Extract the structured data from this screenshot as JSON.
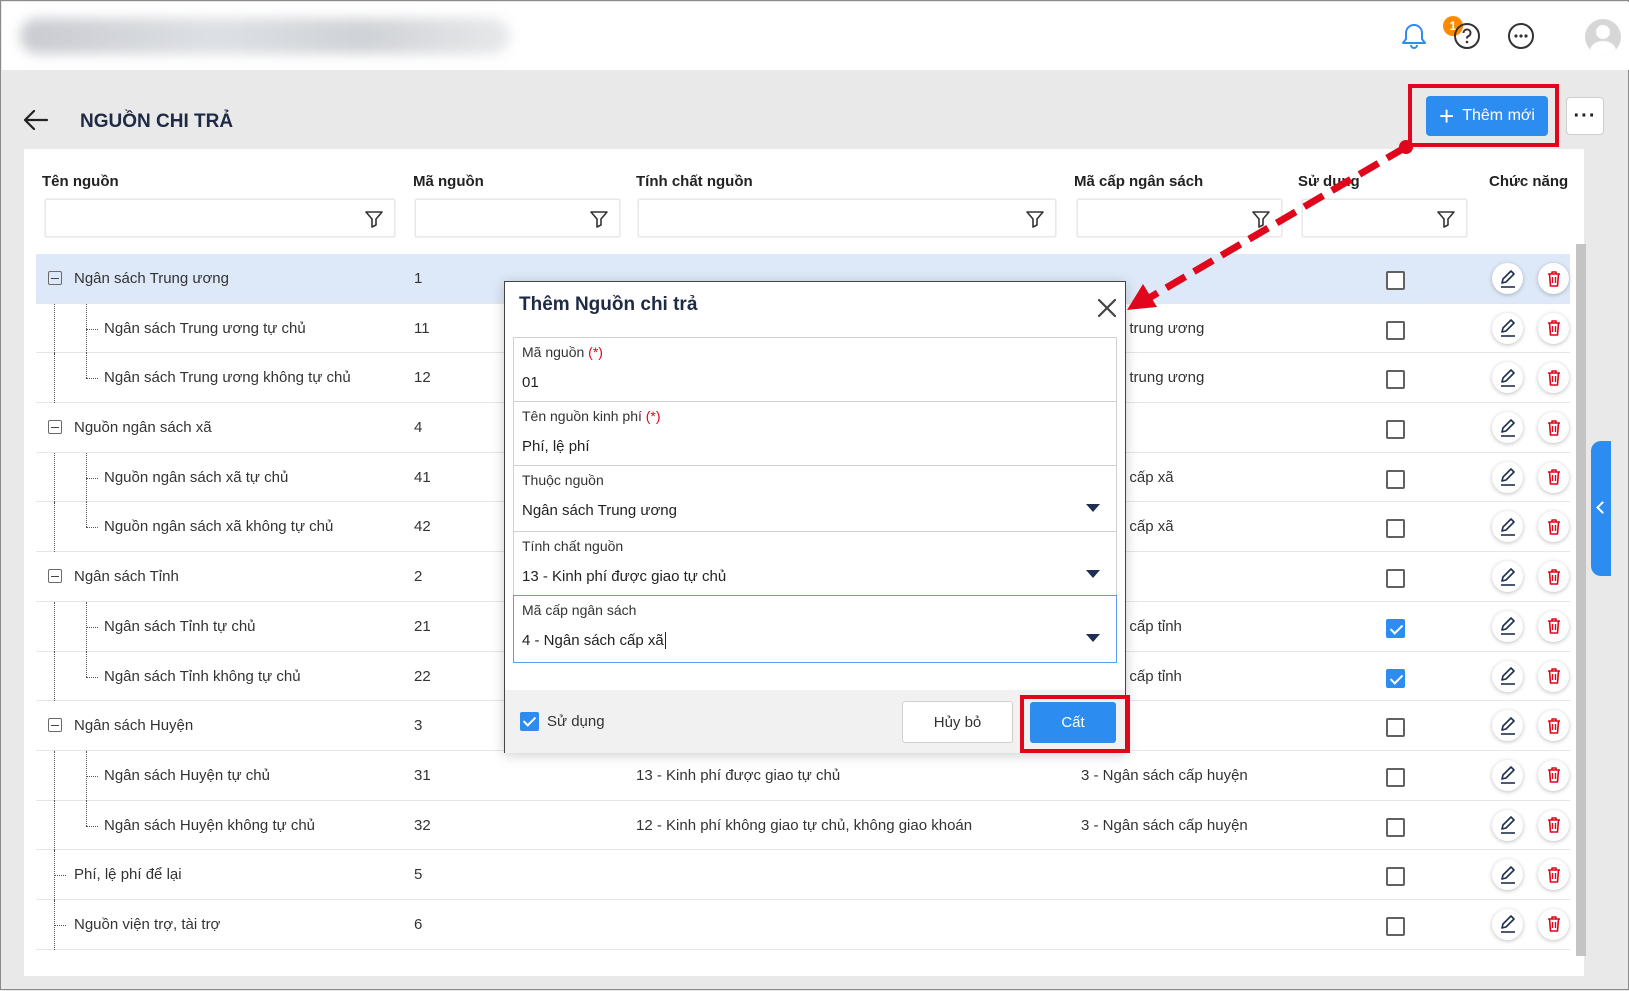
{
  "topbar": {
    "notification_count": "1"
  },
  "header": {
    "title": "NGUỒN CHI TRẢ",
    "add_label": "Thêm mới",
    "more_label": "···"
  },
  "table": {
    "columns": [
      "Tên nguồn",
      "Mã nguồn",
      "Tính chất nguồn",
      "Mã cấp ngân sách",
      "Sử dụng",
      "Chức năng"
    ],
    "rows": [
      {
        "name": "Ngân sách Trung ương",
        "code": "1",
        "nature": "",
        "level": "",
        "used": false
      },
      {
        "name": "Ngân sách Trung ương tự chủ",
        "code": "11",
        "nature": "",
        "level": "n sách trung ương",
        "used": false
      },
      {
        "name": "Ngân sách Trung ương không tự chủ",
        "code": "12",
        "nature": "",
        "level": "n sách trung ương",
        "used": false
      },
      {
        "name": "Nguồn ngân sách xã",
        "code": "4",
        "nature": "",
        "level": "",
        "used": false
      },
      {
        "name": "Nguồn ngân sách xã tự chủ",
        "code": "41",
        "nature": "",
        "level": "n sách cấp xã",
        "used": false
      },
      {
        "name": "Nguồn ngân sách xã không tự chủ",
        "code": "42",
        "nature": "",
        "level": "n sách cấp xã",
        "used": false
      },
      {
        "name": "Ngân sách Tỉnh",
        "code": "2",
        "nature": "",
        "level": "",
        "used": false
      },
      {
        "name": "Ngân sách Tỉnh tự chủ",
        "code": "21",
        "nature": "",
        "level": "n sách cấp tỉnh",
        "used": true
      },
      {
        "name": "Ngân sách Tỉnh không tự chủ",
        "code": "22",
        "nature": "",
        "level": "n sách cấp tỉnh",
        "used": true
      },
      {
        "name": "Ngân sách Huyện",
        "code": "3",
        "nature": "",
        "level": "",
        "used": false
      },
      {
        "name": "Ngân sách Huyện tự chủ",
        "code": "31",
        "nature": "13 - Kinh phí được giao tự chủ",
        "level": "3 - Ngân sách cấp huyện",
        "used": false
      },
      {
        "name": "Ngân sách Huyện không tự chủ",
        "code": "32",
        "nature": "12 - Kinh phí không giao tự chủ, không giao khoán",
        "level": "3 - Ngân sách cấp huyện",
        "used": false
      },
      {
        "name": "Phí, lệ phí để lại",
        "code": "5",
        "nature": "",
        "level": "",
        "used": false
      },
      {
        "name": "Nguồn viện trợ, tài trợ",
        "code": "6",
        "nature": "",
        "level": "",
        "used": false
      }
    ]
  },
  "modal": {
    "title": "Thêm Nguồn chi trả",
    "fields": [
      {
        "label": "Mã nguồn",
        "required": "(*)",
        "value": "01"
      },
      {
        "label": "Tên nguồn kinh phí",
        "required": "(*)",
        "value": "Phí, lệ phí"
      },
      {
        "label": "Thuộc nguồn",
        "required": "",
        "value": "Ngân sách Trung ương"
      },
      {
        "label": "Tính chất nguồn",
        "required": "",
        "value": "13 - Kinh phí được giao tự chủ"
      },
      {
        "label": "Mã cấp ngân sách",
        "required": "",
        "value": "4 - Ngân sách cấp xã"
      }
    ],
    "use_label": "Sử dụng",
    "cancel_label": "Hủy bỏ",
    "save_label": "Cất"
  },
  "colors": {
    "primary": "#2d8cf0",
    "highlight": "#e0061b",
    "selected_row": "#dde9f8"
  }
}
